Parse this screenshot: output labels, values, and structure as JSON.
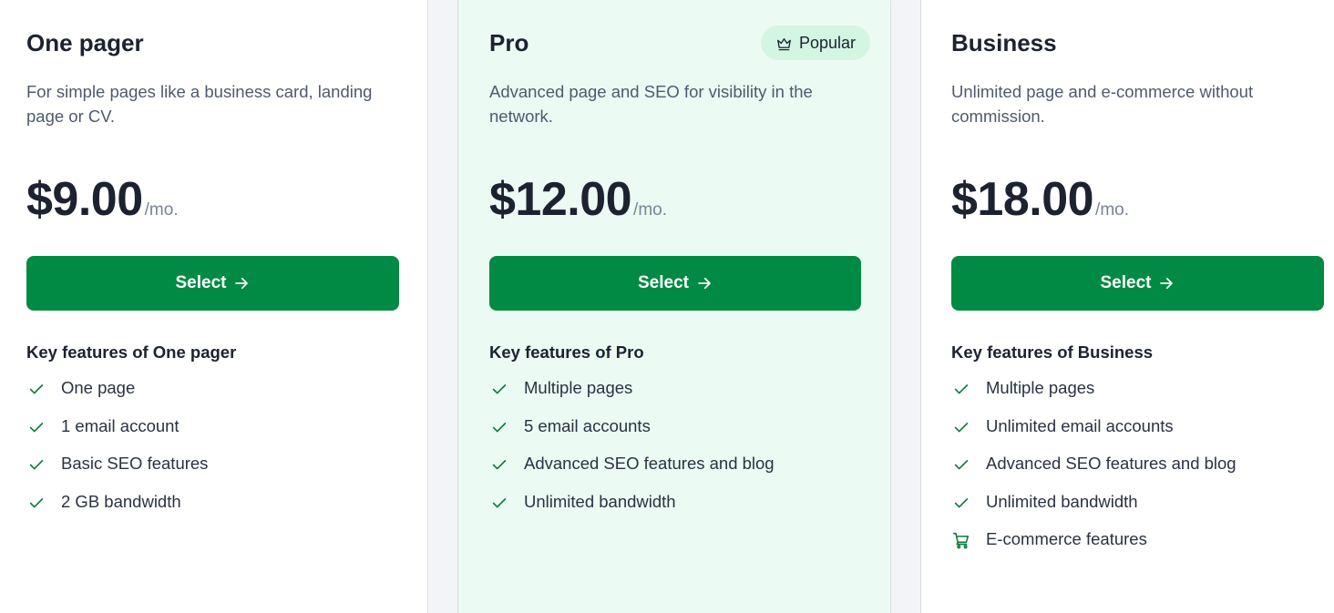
{
  "plans": [
    {
      "name": "One pager",
      "description": "For simple pages like a business card, landing page or CV.",
      "price": "$9.00",
      "period": "/mo.",
      "button_label": "Select",
      "features_title": "Key features of One pager",
      "features": [
        {
          "icon": "check-icon",
          "label": "One page"
        },
        {
          "icon": "check-icon",
          "label": "1 email account"
        },
        {
          "icon": "check-icon",
          "label": "Basic SEO features"
        },
        {
          "icon": "check-icon",
          "label": "2 GB bandwidth"
        }
      ]
    },
    {
      "name": "Pro",
      "badge": "Popular",
      "badge_icon": "crown-icon",
      "description": "Advanced page and SEO for visibility in the network.",
      "price": "$12.00",
      "period": "/mo.",
      "button_label": "Select",
      "features_title": "Key features of Pro",
      "features": [
        {
          "icon": "check-icon",
          "label": "Multiple pages"
        },
        {
          "icon": "check-icon",
          "label": "5 email accounts"
        },
        {
          "icon": "check-icon",
          "label": "Advanced SEO features and blog"
        },
        {
          "icon": "check-icon",
          "label": "Unlimited bandwidth"
        }
      ]
    },
    {
      "name": "Business",
      "description": "Unlimited page and e-commerce without commission.",
      "price": "$18.00",
      "period": "/mo.",
      "button_label": "Select",
      "features_title": "Key features of Business",
      "features": [
        {
          "icon": "check-icon",
          "label": "Multiple pages"
        },
        {
          "icon": "check-icon",
          "label": "Unlimited email accounts"
        },
        {
          "icon": "check-icon",
          "label": "Advanced SEO features and blog"
        },
        {
          "icon": "check-icon",
          "label": "Unlimited bandwidth"
        },
        {
          "icon": "cart-icon",
          "label": "E-commerce features"
        }
      ]
    }
  ],
  "colors": {
    "accent": "#018a43",
    "popular_bg": "#ebfaf2",
    "badge_bg": "#d3f6e3",
    "icon": "#0c7a3e"
  }
}
